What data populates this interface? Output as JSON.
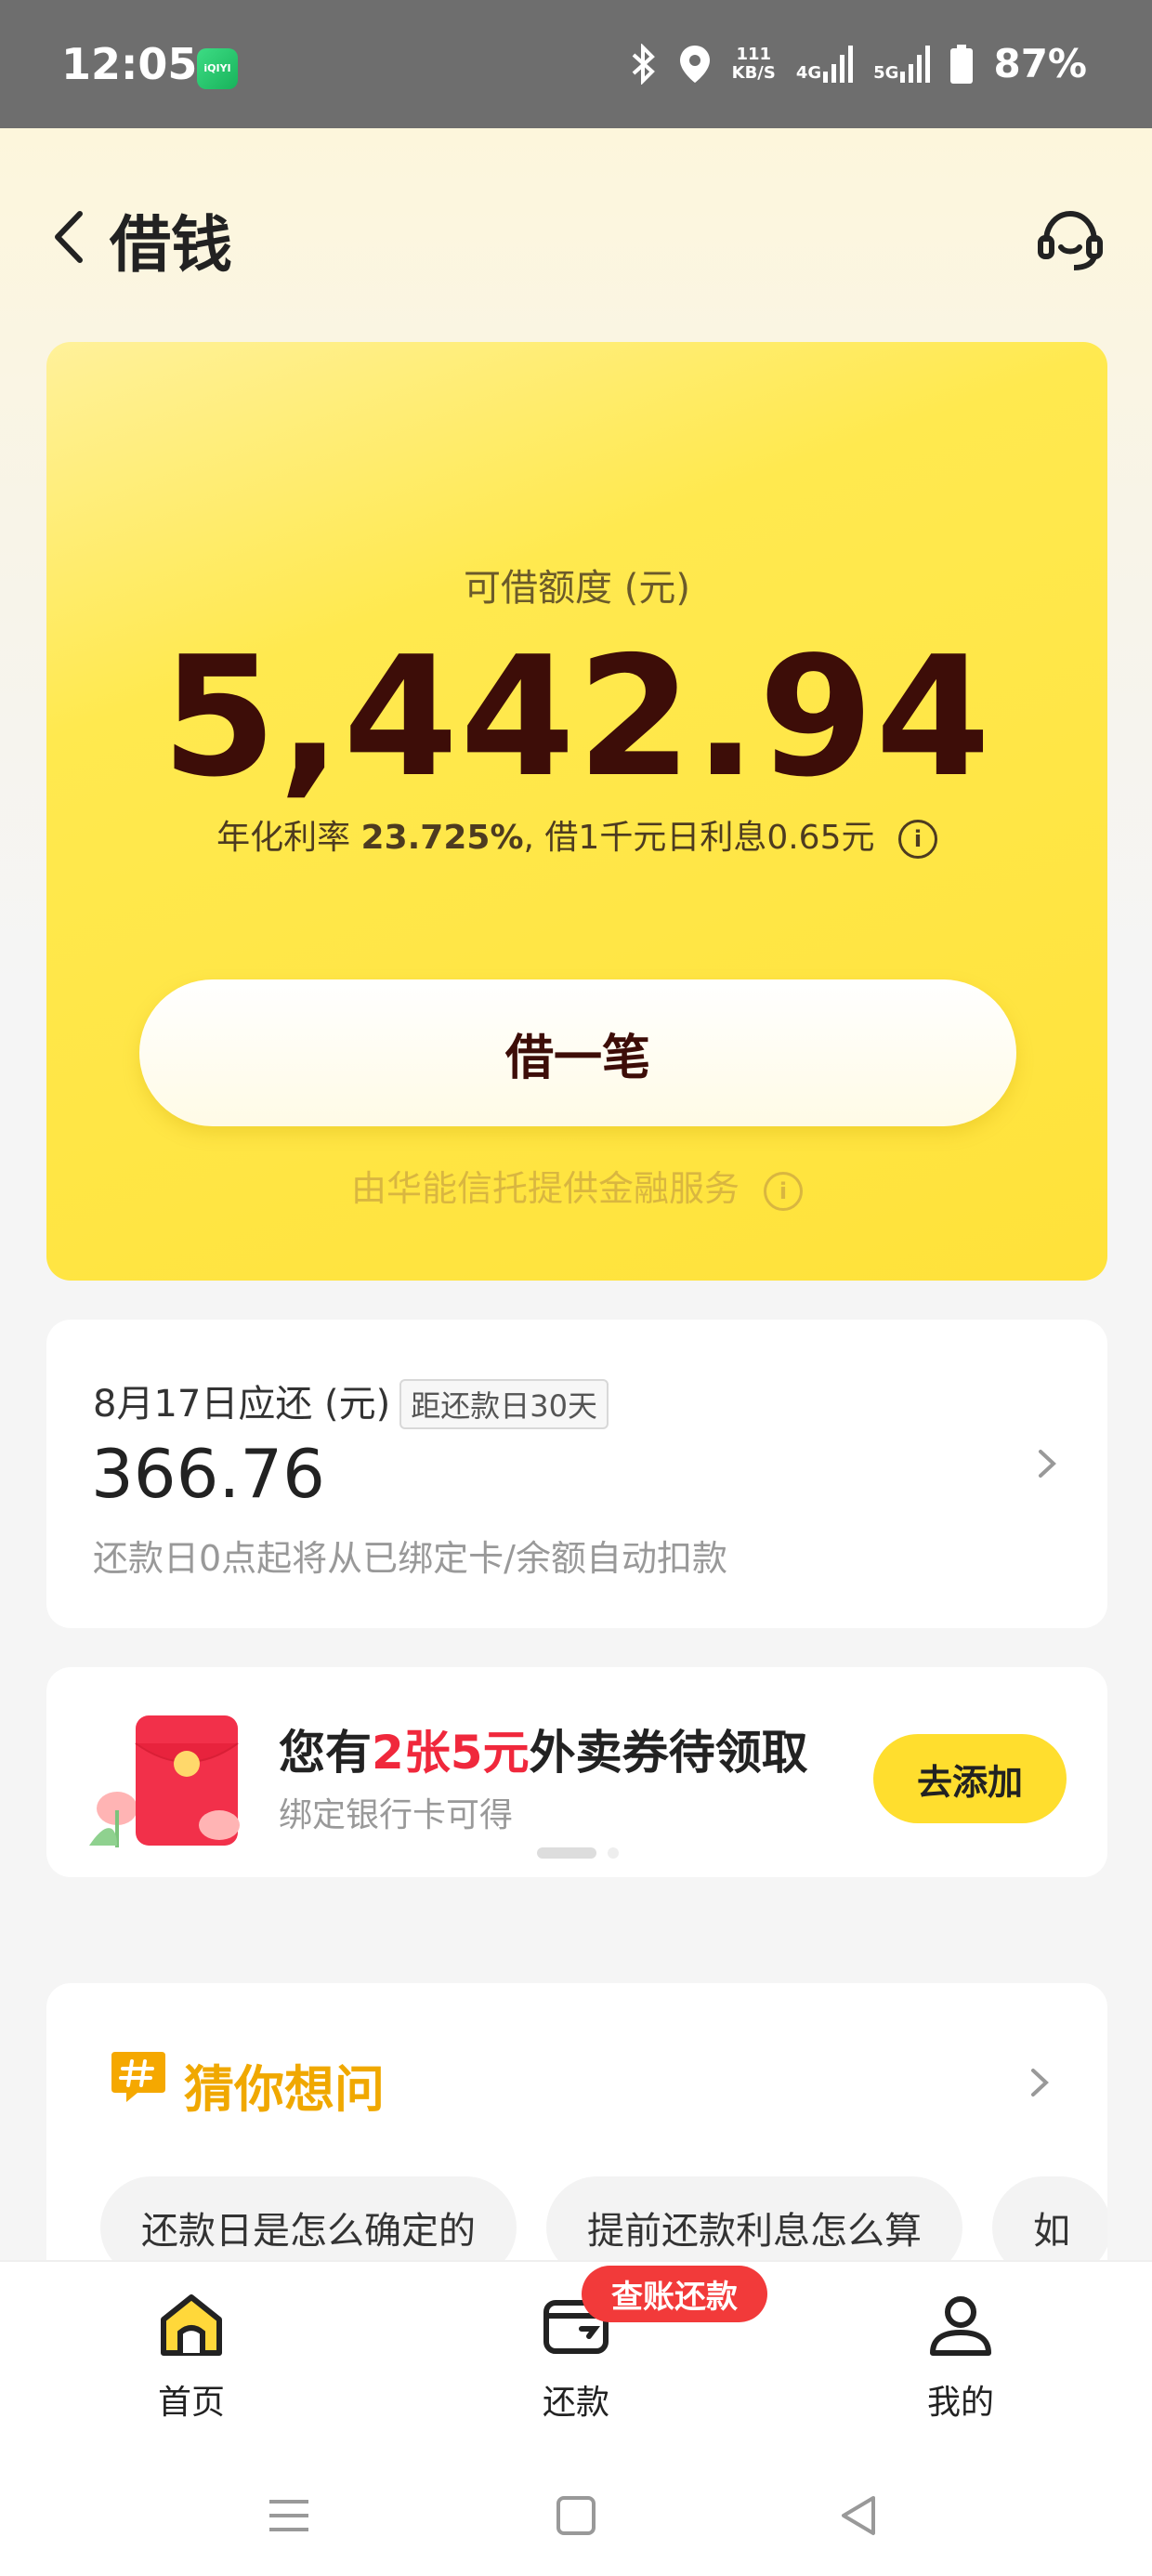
{
  "status_bar": {
    "time": "12:05",
    "app_icon_text": "iQIYI",
    "net_speed_value": "111",
    "net_speed_unit": "KB/S",
    "network_1": "4G",
    "network_2": "5G",
    "battery": "87%"
  },
  "header": {
    "title": "借钱"
  },
  "loan_card": {
    "limit_label": "可借额度 (元)",
    "limit_amount": "5,442.94",
    "rate_prefix": "年化利率",
    "rate_value": "23.725%",
    "rate_suffix": ", 借1千元日利息0.65元",
    "borrow_button": "借一笔",
    "provider": "由华能信托提供金融服务"
  },
  "repayment": {
    "title": "8月17日应还 (元)",
    "days_badge": "距还款日30天",
    "amount": "366.76",
    "note": "还款日0点起将从已绑定卡/余额自动扣款"
  },
  "coupon": {
    "title_prefix": "您有",
    "title_highlight": "2张5元",
    "title_suffix": "外卖券待领取",
    "subtitle": "绑定银行卡可得",
    "button": "去添加"
  },
  "faq": {
    "title": "猜你想问",
    "chips": [
      "还款日是怎么确定的",
      "提前还款利息怎么算",
      "如"
    ]
  },
  "tabbar": {
    "home": "首页",
    "repay": "还款",
    "repay_badge": "查账还款",
    "mine": "我的"
  },
  "colors": {
    "card_yellow": "#ffe23a",
    "amount_dark": "#3d0d08",
    "highlight_red": "#f0283c",
    "faq_orange": "#f0a800",
    "badge_red": "#f23a3a"
  }
}
